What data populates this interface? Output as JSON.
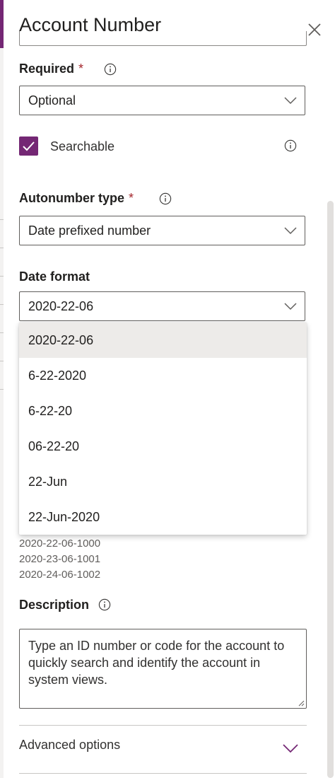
{
  "panel": {
    "title": "Account Number"
  },
  "required": {
    "label": "Required",
    "asterisk": "*",
    "value": "Optional"
  },
  "searchable": {
    "label": "Searchable",
    "checked": true
  },
  "autonumber": {
    "label": "Autonumber type",
    "asterisk": "*",
    "value": "Date prefixed number"
  },
  "date_format": {
    "label": "Date format",
    "value": "2020-22-06",
    "options": [
      "2020-22-06",
      "6-22-2020",
      "6-22-20",
      "06-22-20",
      "22-Jun",
      "22-Jun-2020"
    ],
    "selected_index": 0
  },
  "samples": [
    "2020-22-06-1000",
    "2020-23-06-1001",
    "2020-24-06-1002"
  ],
  "description": {
    "label": "Description",
    "value": "Type an ID number or code for the account to quickly search and identify the account in system views."
  },
  "advanced": {
    "label": "Advanced options"
  },
  "colors": {
    "accent": "#742774",
    "required_asterisk": "#a4262c",
    "selected_option_bg": "#edebe9"
  },
  "icons": {
    "close": "close-icon",
    "info": "info-icon",
    "chevron": "chevron-down-icon",
    "check": "checkmark-icon"
  }
}
